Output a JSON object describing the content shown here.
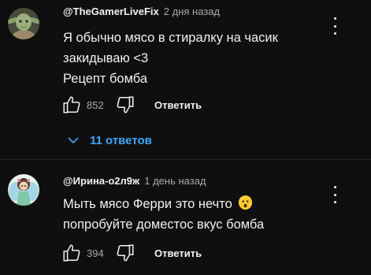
{
  "comments": [
    {
      "author": "@TheGamerLiveFix",
      "time": "2 дня назад",
      "lines": [
        "Я обычно мясо в стиралку на часик",
        "закидываю <3",
        "Рецепт бомба"
      ],
      "likes": "852",
      "reply_label": "Ответить",
      "avatar_icon": "yoda-avatar",
      "replies_label": "11 ответов"
    },
    {
      "author": "@Ирина-о2л9ж",
      "time": "1 день назад",
      "lines": [
        "Мыть мясо Ферри это нечто",
        "попробуйте доместос вкус бомба"
      ],
      "emoji": "astonished-face-emoji",
      "likes": "394",
      "reply_label": "Ответить",
      "avatar_icon": "fairy-avatar"
    }
  ],
  "colors": {
    "background": "#0f0f0f",
    "text": "#f1f1f1",
    "muted": "#aaaaaa",
    "link": "#3ea6ff"
  }
}
